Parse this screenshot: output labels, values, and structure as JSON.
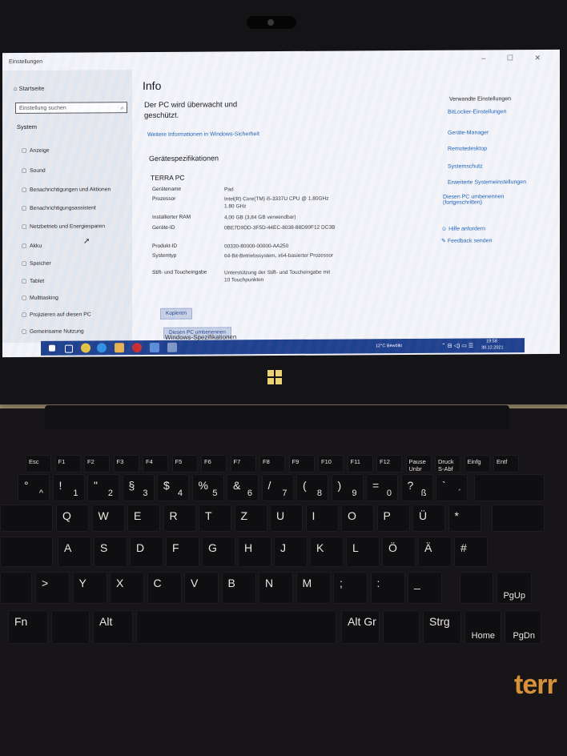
{
  "window": {
    "title": "Einstellungen",
    "controls": "–   ☐   ✕"
  },
  "sidebar": {
    "home": "Startseite",
    "search_placeholder": "Einstellung suchen",
    "category": "System",
    "items": [
      {
        "label": "Anzeige",
        "icon": "monitor-icon"
      },
      {
        "label": "Sound",
        "icon": "speaker-icon"
      },
      {
        "label": "Benachrichtigungen und Aktionen",
        "icon": "notification-icon"
      },
      {
        "label": "Benachrichtigungsassistent",
        "icon": "moon-icon"
      },
      {
        "label": "Netzbetrieb und Energiesparen",
        "icon": "power-icon"
      },
      {
        "label": "Akku",
        "icon": "battery-icon"
      },
      {
        "label": "Speicher",
        "icon": "storage-icon"
      },
      {
        "label": "Tablet",
        "icon": "tablet-icon"
      },
      {
        "label": "Multitasking",
        "icon": "multitasking-icon"
      },
      {
        "label": "Projizieren auf diesen PC",
        "icon": "project-icon"
      },
      {
        "label": "Gemeinsame Nutzung",
        "icon": "share-icon"
      }
    ]
  },
  "main": {
    "title": "Info",
    "protection_line1": "Der PC wird überwacht und",
    "protection_line2": "geschützt.",
    "security_link": "Weitere Informationen in Windows-Sicherheit",
    "device_specs_heading": "Gerätespezifikationen",
    "device_title": "TERRA PC",
    "specs": [
      {
        "label": "Gerätename",
        "value": "Pad"
      },
      {
        "label": "Prozessor",
        "value": "Intel(R) Core(TM) i5-3337U CPU @ 1.80GHz   1.80 GHz"
      },
      {
        "label": "Installierter RAM",
        "value": "4,00 GB (3,84 GB verwendbar)"
      },
      {
        "label": "Geräte-ID",
        "value": "0BE7D9DD-3F5D-44EC-8038-88D99F12 DC3B"
      },
      {
        "label": "Produkt-ID",
        "value": "00330-80000-00000-AA250"
      },
      {
        "label": "Systemtyp",
        "value": "64-Bit-Betriebssystem, x64-basierter Prozessor"
      },
      {
        "label": "Stift- und Toucheingabe",
        "value": "Unterstützung der Stift- und Toucheingabe mit 10 Touchpunkten"
      }
    ],
    "copy_button": "Kopieren",
    "rename_button": "Diesen PC umbenennen",
    "windows_specs_heading": "Windows-Spezifikationen"
  },
  "related": {
    "heading": "Verwandte Einstellungen",
    "links": [
      "BitLocker-Einstellungen",
      "Geräte-Manager",
      "Remotedesktop",
      "Systemschutz",
      "Erweiterte Systemeinstellungen",
      "Diesen PC umbenennen (fortgeschritten)"
    ],
    "help": "Hilfe anfordern",
    "feedback": "Feedback senden"
  },
  "taskbar": {
    "weather": "12°C  Bewölkt",
    "time": "19:58",
    "date": "30.12.2021"
  },
  "keyboard": {
    "fkeys": [
      "Esc",
      "F1",
      "F2",
      "F3",
      "F4",
      "F5",
      "F6",
      "F7",
      "F8",
      "F9",
      "F10",
      "F11",
      "F12",
      "Pause Unbr",
      "Druck S-Abf",
      "Einfg",
      "Entf"
    ],
    "row1": [
      [
        "°",
        "^"
      ],
      [
        "!",
        "1"
      ],
      [
        "\"",
        "2"
      ],
      [
        "§",
        "3"
      ],
      [
        "$",
        "4"
      ],
      [
        "%",
        "5"
      ],
      [
        "&",
        "6"
      ],
      [
        "/",
        "7"
      ],
      [
        "(",
        "8"
      ],
      [
        ")",
        "9"
      ],
      [
        "=",
        "0"
      ],
      [
        "?",
        "ß"
      ],
      [
        "`",
        "´"
      ]
    ],
    "row2": [
      "Q",
      "W",
      "E",
      "R",
      "T",
      "Z",
      "U",
      "I",
      "O",
      "P",
      "Ü",
      "*"
    ],
    "row3": [
      "A",
      "S",
      "D",
      "F",
      "G",
      "H",
      "J",
      "K",
      "L",
      "Ö",
      "Ä",
      "#"
    ],
    "row4": [
      ">",
      "Y",
      "X",
      "C",
      "V",
      "B",
      "N",
      "M",
      ";",
      ":",
      "_"
    ],
    "alt": "Alt",
    "altgr": "Alt Gr",
    "strg": "Strg",
    "fn": "Fn",
    "pgup": "PgUp",
    "pgdn": "PgDn",
    "home": "Home"
  },
  "brand": "terr"
}
